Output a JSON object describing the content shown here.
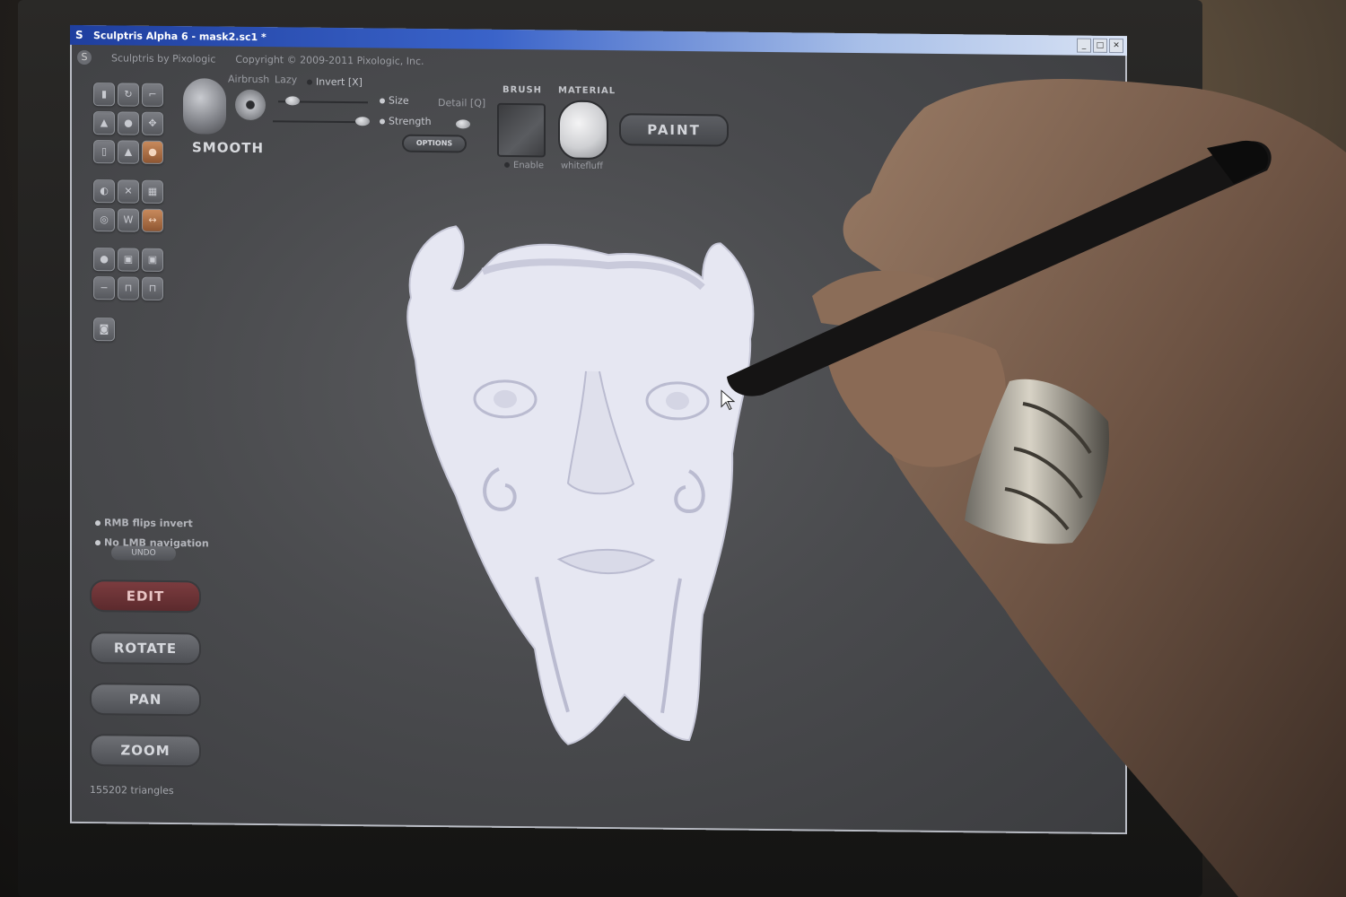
{
  "window": {
    "title": "Sculptris Alpha 6 - mask2.sc1 *",
    "app_logo": "S",
    "controls": [
      "_",
      "□",
      "✕"
    ]
  },
  "subtitle": {
    "credit": "Sculptris by Pixologic",
    "copyright": "Copyright © 2009-2011 Pixologic, Inc."
  },
  "brush": {
    "name": "SMOOTH",
    "airbrush_label": "Airbrush",
    "lazy_label": "Lazy",
    "invert_label": "Invert [X]",
    "size_label": "Size",
    "detail_label": "Detail [Q]",
    "strength_label": "Strength",
    "options_label": "OPTIONS"
  },
  "brush_panel": {
    "header": "BRUSH",
    "enable_label": "Enable"
  },
  "material_panel": {
    "header": "MATERIAL",
    "material_name": "whitefluff"
  },
  "paint_button": "PAINT",
  "hints": {
    "rmb": "RMB flips invert",
    "lmb": "No LMB navigation"
  },
  "undo_label": "UNDO",
  "nav_buttons": {
    "edit": "EDIT",
    "rotate": "ROTATE",
    "pan": "PAN",
    "zoom": "ZOOM"
  },
  "status": "155202 triangles",
  "tool_icons": [
    "draw-icon",
    "crease-icon",
    "flatten-icon",
    "inflate-icon",
    "pinch-icon",
    "grab-icon",
    "scale-icon",
    "rotate-brush-icon",
    "smooth-icon",
    "symmetry-icon",
    "wireframe-icon",
    "grid-icon",
    "mask-icon",
    "w-icon",
    "reduce-icon",
    "sphere-icon",
    "plane-icon",
    "material-icon",
    "minus-icon",
    "export-icon",
    "import-icon",
    "camera-icon"
  ],
  "colors": {
    "screen_bg": "#4a4b4e",
    "active_tool": "#c88a5c",
    "edit_button": "#7b3c3f",
    "model": "#e8e9f4"
  }
}
